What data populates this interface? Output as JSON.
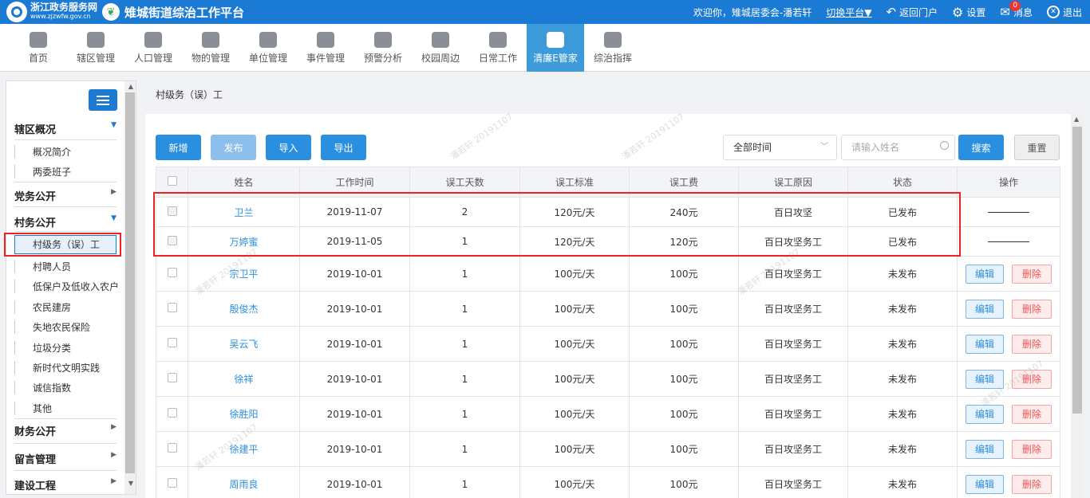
{
  "header": {
    "site_name": "浙江政务服务网",
    "site_url": "www.zjzwfw.gov.cn",
    "platform_title": "雉城街道综治工作平台",
    "welcome": "欢迎你，雉城居委会-潘若轩",
    "switch_label": "切换平台▼",
    "back_label": "返回门户",
    "settings_label": "设置",
    "message_label": "消息",
    "message_count": "0",
    "logout_label": "退出"
  },
  "nav": [
    {
      "label": "首页"
    },
    {
      "label": "辖区管理"
    },
    {
      "label": "人口管理"
    },
    {
      "label": "物的管理"
    },
    {
      "label": "单位管理"
    },
    {
      "label": "事件管理"
    },
    {
      "label": "预警分析"
    },
    {
      "label": "校园周边"
    },
    {
      "label": "日常工作"
    },
    {
      "label": "清廉E管家"
    },
    {
      "label": "综治指挥"
    }
  ],
  "sidebar": {
    "sections": [
      {
        "label": "辖区概况",
        "caret": "▼"
      },
      {
        "label": "党务公开",
        "caret": "▶"
      },
      {
        "label": "村务公开",
        "caret": "▼"
      },
      {
        "label": "财务公开",
        "caret": "▶"
      },
      {
        "label": "留言管理",
        "caret": "▶"
      },
      {
        "label": "建设工程",
        "caret": "▶"
      }
    ],
    "subs": [
      {
        "label": "概况简介"
      },
      {
        "label": "两委班子"
      },
      {
        "label": "村级务（误）工"
      },
      {
        "label": "村聘人员"
      },
      {
        "label": "低保户及低收入农户"
      },
      {
        "label": "农民建房"
      },
      {
        "label": "失地农民保险"
      },
      {
        "label": "垃圾分类"
      },
      {
        "label": "新时代文明实践"
      },
      {
        "label": "诚信指数"
      },
      {
        "label": "其他"
      }
    ]
  },
  "breadcrumb": "村级务（误）工",
  "toolbar": {
    "add": "新增",
    "publish": "发布",
    "import": "导入",
    "export": "导出",
    "time_select": "全部时间",
    "search_placeholder": "请输入姓名",
    "search": "搜索",
    "reset": "重置"
  },
  "table": {
    "headers": [
      "姓名",
      "工作时间",
      "误工天数",
      "误工标准",
      "误工费",
      "误工原因",
      "状态",
      "操作"
    ],
    "rows": [
      {
        "name": "卫兰",
        "date": "2019-11-07",
        "days": "2",
        "rate": "120元/天",
        "fee": "240元",
        "reason": "百日攻坚",
        "status": "已发布"
      },
      {
        "name": "万婷蜜",
        "date": "2019-11-05",
        "days": "1",
        "rate": "120元/天",
        "fee": "120元",
        "reason": "百日攻坚务工",
        "status": "已发布"
      },
      {
        "name": "宗卫平",
        "date": "2019-10-01",
        "days": "1",
        "rate": "100元/天",
        "fee": "100元",
        "reason": "百日攻坚务工",
        "status": "未发布"
      },
      {
        "name": "殷俊杰",
        "date": "2019-10-01",
        "days": "1",
        "rate": "100元/天",
        "fee": "100元",
        "reason": "百日攻坚务工",
        "status": "未发布"
      },
      {
        "name": "吴云飞",
        "date": "2019-10-01",
        "days": "1",
        "rate": "100元/天",
        "fee": "100元",
        "reason": "百日攻坚务工",
        "status": "未发布"
      },
      {
        "name": "徐祥",
        "date": "2019-10-01",
        "days": "1",
        "rate": "100元/天",
        "fee": "100元",
        "reason": "百日攻坚务工",
        "status": "未发布"
      },
      {
        "name": "徐胜阳",
        "date": "2019-10-01",
        "days": "1",
        "rate": "100元/天",
        "fee": "100元",
        "reason": "百日攻坚务工",
        "status": "未发布"
      },
      {
        "name": "徐建平",
        "date": "2019-10-01",
        "days": "1",
        "rate": "100元/天",
        "fee": "100元",
        "reason": "百日攻坚务工",
        "status": "未发布"
      },
      {
        "name": "周雨良",
        "date": "2019-10-01",
        "days": "1",
        "rate": "100元/天",
        "fee": "100元",
        "reason": "百日攻坚务工",
        "status": "未发布"
      }
    ],
    "edit_label": "编辑",
    "delete_label": "删除",
    "published_op": "————"
  },
  "watermark": {
    "name": "潘若轩",
    "date": "20191107"
  },
  "colors": {
    "primary": "#1a7ad4",
    "active_nav": "#3d9bd9",
    "highlight": "#e22222"
  }
}
